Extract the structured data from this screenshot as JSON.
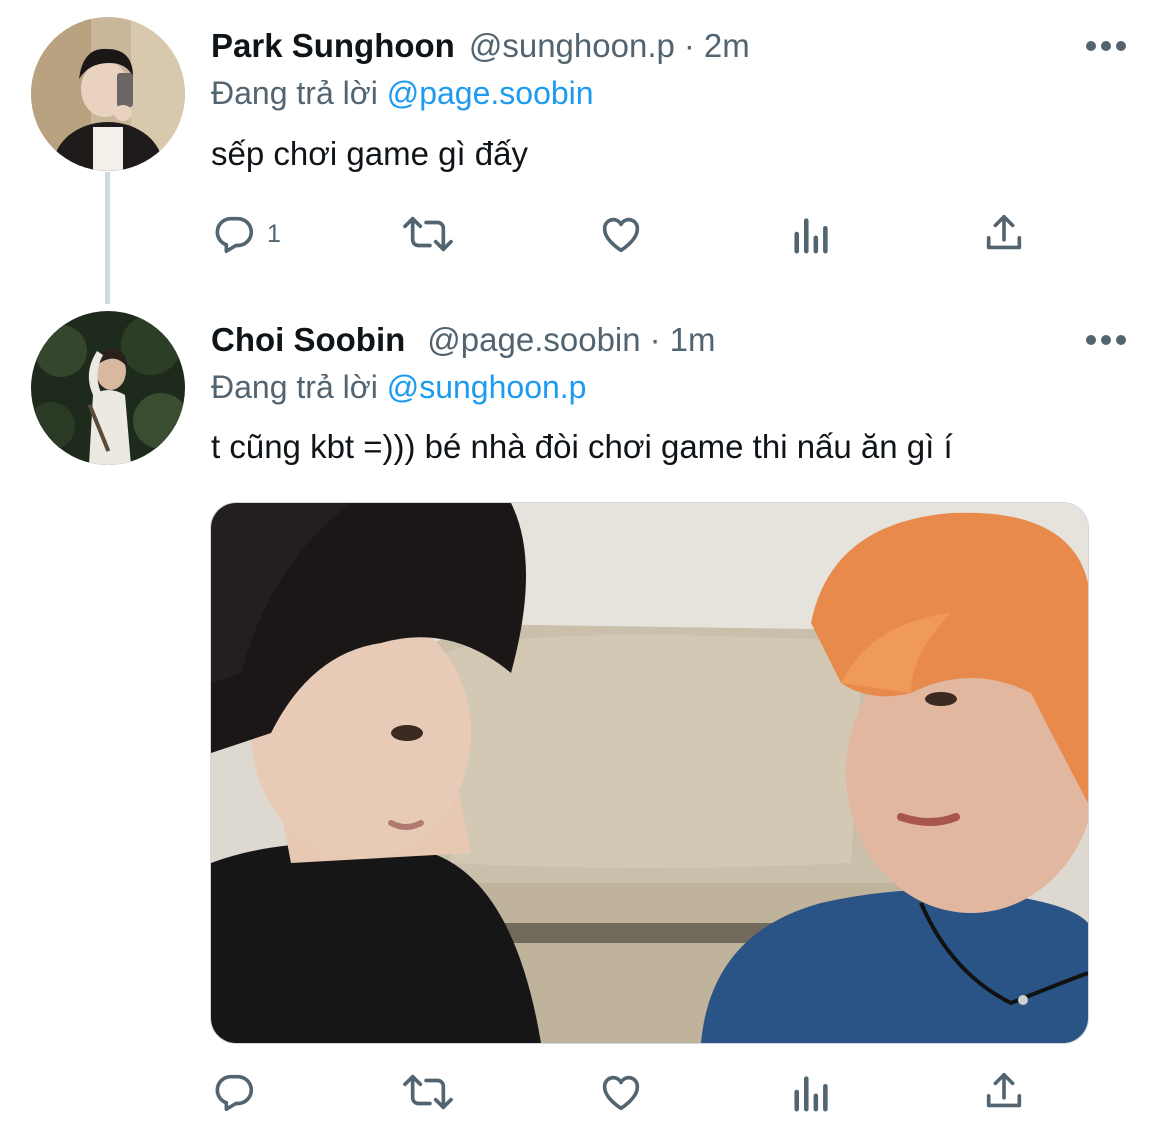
{
  "colors": {
    "text": "#0f1419",
    "secondary": "#536471",
    "link": "#1d9bf0",
    "divider": "#cfd9de"
  },
  "tweets": [
    {
      "name": "Park Sunghoon",
      "handle": "@sunghoon.p",
      "separator": "·",
      "time": "2m",
      "reply_prefix": "Đang trả lời",
      "reply_to": "@page.soobin",
      "text": "sếp chơi game gì đấy",
      "reply_count": "1",
      "icons": [
        "reply-icon",
        "retweet-icon",
        "like-icon",
        "views-icon",
        "share-icon",
        "more-icon"
      ]
    },
    {
      "name": "Choi Soobin",
      "handle": "@page.soobin",
      "separator": "·",
      "time": "1m",
      "reply_prefix": "Đang trả lời",
      "reply_to": "@sunghoon.p",
      "text": "t cũng kbt =))) bé nhà đòi chơi game thi nấu ăn gì í",
      "reply_count": "",
      "has_media": true,
      "icons": [
        "reply-icon",
        "retweet-icon",
        "like-icon",
        "views-icon",
        "share-icon",
        "more-icon"
      ]
    }
  ]
}
